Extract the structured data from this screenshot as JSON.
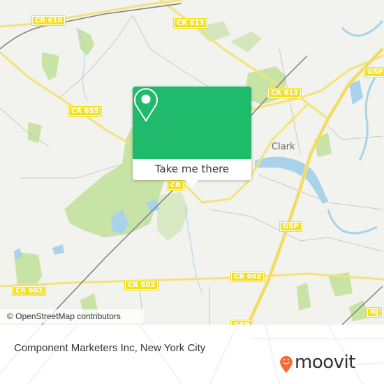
{
  "map": {
    "road_labels": [
      {
        "id": "cr610",
        "text": "CR 610"
      },
      {
        "id": "cr613-top",
        "text": "CR 613"
      },
      {
        "id": "cr613-right",
        "text": "CR 613"
      },
      {
        "id": "cr655",
        "text": "CR 655"
      },
      {
        "id": "gsp-top",
        "text": "GSP"
      },
      {
        "id": "gsp-mid",
        "text": "GSP"
      },
      {
        "id": "gsp-bottom",
        "text": "GSP"
      },
      {
        "id": "cr602-left",
        "text": "CR 602"
      },
      {
        "id": "cr602-mid",
        "text": "CR 602"
      },
      {
        "id": "cr602-right",
        "text": "CR 602"
      },
      {
        "id": "nj",
        "text": "NJ"
      },
      {
        "id": "cr-partial",
        "text": "CR"
      }
    ],
    "place_labels": [
      {
        "text": "Clark"
      }
    ],
    "attribution": "© OpenStreetMap contributors",
    "colors": {
      "land": "#f2f2ee",
      "park": "#c8e3a6",
      "water": "#a8d3ea",
      "road_major": "#f5e27a",
      "shield": "#f3e01f"
    }
  },
  "popup": {
    "icon": "location-pin-icon",
    "action_label": "Take me there",
    "accent_color": "#1fba6b"
  },
  "footer": {
    "title": "Component Marketers Inc, New York City",
    "brand": "moovit",
    "brand_color": "#f26b36"
  }
}
